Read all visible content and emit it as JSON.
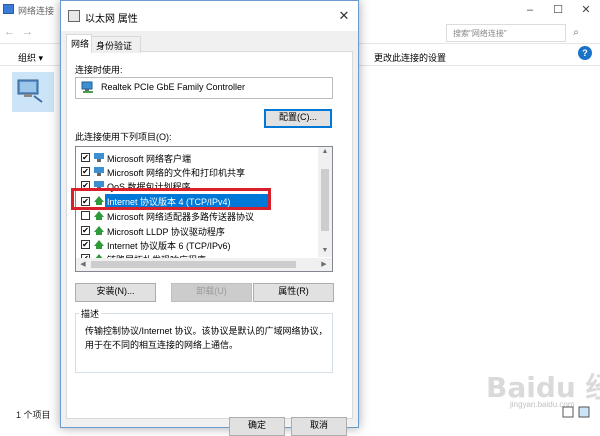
{
  "background_window": {
    "title": "网络连接",
    "search_placeholder": "搜索\"网络连接\"",
    "toolbar": {
      "organize": "组织 ▾",
      "change_settings": "更改此连接的设置"
    },
    "status": "1 个项目"
  },
  "dialog": {
    "title": "以太网 属性",
    "tabs": [
      {
        "label": "网络"
      },
      {
        "label": "身份验证"
      }
    ],
    "connect_using_label": "连接时使用:",
    "adapter_name": "Realtek PCIe GbE Family Controller",
    "configure_button": "配置(C)...",
    "items_label": "此连接使用下列项目(O):",
    "items": [
      {
        "label": "Microsoft 网络客户端",
        "checked": true
      },
      {
        "label": "Microsoft 网络的文件和打印机共享",
        "checked": true
      },
      {
        "label": "QoS 数据包计划程序",
        "checked": true
      },
      {
        "label": "Internet 协议版本 4 (TCP/IPv4)",
        "checked": true,
        "selected": true
      },
      {
        "label": "Microsoft 网络适配器多路传送器协议",
        "checked": false
      },
      {
        "label": "Microsoft LLDP 协议驱动程序",
        "checked": true
      },
      {
        "label": "Internet 协议版本 6 (TCP/IPv6)",
        "checked": true
      },
      {
        "label": "链路层拓扑发现响应程序",
        "checked": true
      }
    ],
    "buttons": {
      "install": "安装(N)...",
      "uninstall": "卸载(U)",
      "properties": "属性(R)"
    },
    "description_title": "描述",
    "description_text": "传输控制协议/Internet 协议。该协议是默认的广域网络协议，用于在不同的相互连接的网络上通信。",
    "ok": "确定",
    "cancel": "取消"
  },
  "check_mark": "✔",
  "watermark": {
    "text": "Baidu 经验",
    "url": "jingyan.baidu.com"
  },
  "colors": {
    "accent": "#0078d7",
    "highlight_box": "#d9202a"
  }
}
